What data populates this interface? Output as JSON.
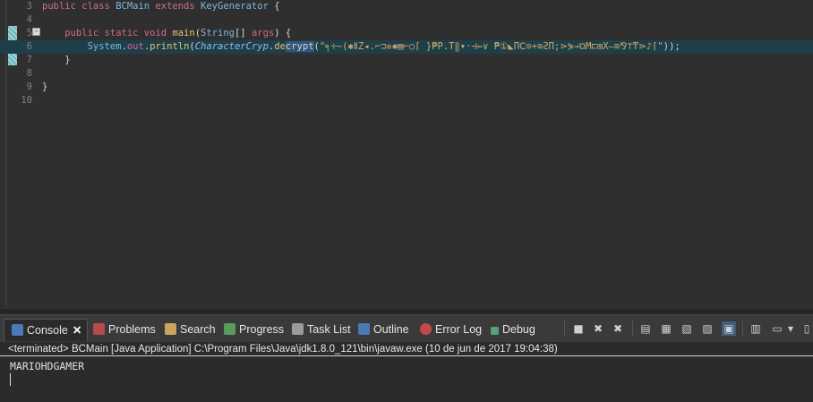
{
  "editor": {
    "lines": [
      {
        "n": "3",
        "parts": [
          [
            "kw",
            "public class "
          ],
          [
            "ty",
            "BCMain "
          ],
          [
            "kw",
            "extends "
          ],
          [
            "ty",
            "KeyGenerator "
          ],
          [
            "pl",
            "{"
          ]
        ]
      },
      {
        "n": "4",
        "parts": []
      },
      {
        "n": "5",
        "parts": [
          [
            "pl",
            "    "
          ],
          [
            "kw",
            "public static void "
          ],
          [
            "fn",
            "main"
          ],
          [
            "pl",
            "("
          ],
          [
            "ty",
            "String"
          ],
          [
            "pl",
            "[] "
          ],
          [
            "kw",
            "args"
          ],
          [
            "pl",
            ") {"
          ]
        ]
      },
      {
        "n": "6",
        "parts": [
          [
            "pl",
            "        "
          ],
          [
            "ty",
            "System"
          ],
          [
            "pl",
            "."
          ],
          [
            "kw",
            "out"
          ],
          [
            "pl",
            "."
          ],
          [
            "fn",
            "println"
          ],
          [
            "pl",
            "("
          ],
          [
            "it",
            "CharacterCryp"
          ],
          [
            "pl",
            "."
          ],
          [
            "fn",
            "de"
          ],
          [
            "sel",
            "crypt"
          ],
          [
            "pl",
            "("
          ],
          [
            "str",
            "\"╕÷~(✱ⅡZ◂.⌐⊐✲✱▤⌐○⌈ }₱P.T‖▾·⊣⇐∨ ̈₱①◣ΠⅭ⊙+≋ƧΠ;⋗⋟→⧉M⊏⊞X–≋⅋⊤₸⋗♪⌈\""
          ],
          [
            "pl",
            "));"
          ]
        ]
      },
      {
        "n": "7",
        "parts": [
          [
            "pl",
            "    }"
          ]
        ]
      },
      {
        "n": "8",
        "parts": []
      },
      {
        "n": "9",
        "parts": [
          [
            "pl",
            "}"
          ]
        ]
      },
      {
        "n": "10",
        "parts": []
      }
    ]
  },
  "panel": {
    "tabs": [
      {
        "label": "Console",
        "icon": "console-icon"
      },
      {
        "label": "Problems",
        "icon": "problems-icon"
      },
      {
        "label": "Search",
        "icon": "search-icon"
      },
      {
        "label": "Progress",
        "icon": "progress-icon"
      },
      {
        "label": "Task List",
        "icon": "task-list-icon"
      },
      {
        "label": "Outline",
        "icon": "outline-icon"
      },
      {
        "label": "Error Log",
        "icon": "error-log-icon"
      },
      {
        "label": "Debug",
        "icon": "debug-icon"
      }
    ],
    "status": "<terminated> BCMain [Java Application] C:\\Program Files\\Java\\jdk1.8.0_121\\bin\\javaw.exe (10 de jun de 2017 19:04:38)",
    "output": "MARIOHDGAMER"
  },
  "colors": {
    "keyword": "#cc6c8f",
    "type": "#7bb7e0",
    "current_line": "#1f3f48",
    "background": "#2b2b2b"
  }
}
